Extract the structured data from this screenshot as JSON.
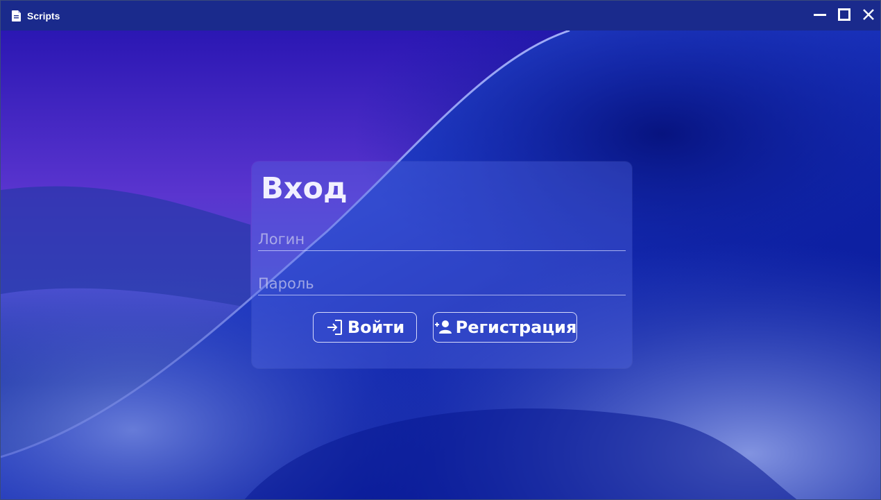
{
  "window": {
    "title": "Scripts",
    "icon": "document-icon",
    "controls": [
      "minimize-icon",
      "maximize-icon",
      "close-icon"
    ]
  },
  "login": {
    "title": "Вход",
    "login_placeholder": "Логин",
    "password_placeholder": "Пароль",
    "login_value": "",
    "password_value": "",
    "signin_label": "Войти",
    "signin_icon": "sign-in-icon",
    "register_label": "Регистрация",
    "register_icon": "add-user-icon"
  },
  "colors": {
    "titlebar": "#1a2a8c",
    "accent": "#2f2cc4",
    "background_dark": "#0b1fa0"
  }
}
